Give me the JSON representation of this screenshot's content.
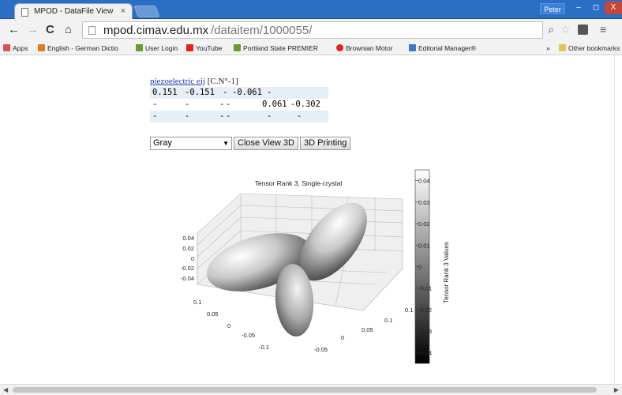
{
  "browser": {
    "tab_title": "MPOD - DataFile View",
    "tab_close": "×",
    "user": "Peter",
    "window_buttons": [
      "–",
      "◻",
      "X"
    ],
    "url_host": "mpod.cimav.edu.mx",
    "url_path": "/dataitem/1000055/"
  },
  "bookmarks": [
    {
      "label": "Apps",
      "color": "#d9534f"
    },
    {
      "label": "English - German Dictio",
      "color": "#e07b22"
    },
    {
      "label": "User Login",
      "color": "#6a9a2a"
    },
    {
      "label": "YouTube",
      "color": "#e62117"
    },
    {
      "label": "Portland State PREMIER",
      "color": "#6a9a2a"
    },
    {
      "label": "Brownian Motor",
      "color": "#e62117"
    },
    {
      "label": "Editorial Manager®",
      "color": "#3a7ac6"
    },
    {
      "label": "»",
      "color": ""
    },
    {
      "label": "Other bookmarks",
      "color": "#e8c25a"
    }
  ],
  "property": {
    "link_text": "piezoelectric eij",
    "units": "[C.N°-1]"
  },
  "matrix": [
    [
      "0.151",
      "-0.151",
      "-",
      "-0.061",
      "-",
      ""
    ],
    [
      "-",
      "-",
      "-",
      "-",
      "0.061",
      "-0.302"
    ],
    [
      "-",
      "-",
      "-",
      "-",
      "-",
      "-"
    ]
  ],
  "controls": {
    "colormap_selected": "Gray",
    "close_view_label": "Close View 3D",
    "print_label": "3D Printing"
  },
  "chart_data": {
    "type": "surface3d",
    "title": "Tensor Rank 3, Single-crystal",
    "colorbar_label": "Tensor Rank 3 Values",
    "colorbar_ticks": [
      "0.04",
      "0.03",
      "0.02",
      "0.01",
      "0",
      "-0.01",
      "-0.02",
      "-0.03",
      "-0.04"
    ],
    "colorbar_range": [
      -0.045,
      0.045
    ],
    "z_ticks": [
      "0.04",
      "0.02",
      "0",
      "-0.02",
      "-0.04"
    ],
    "x_ticks": [
      "0.1",
      "0.05",
      "0",
      "-0.05",
      "-0.1"
    ],
    "y_ticks": [
      "-0.05",
      "0",
      "0.05",
      "0.1"
    ],
    "y_extra_tick": "0.1",
    "colormap": "gray"
  }
}
